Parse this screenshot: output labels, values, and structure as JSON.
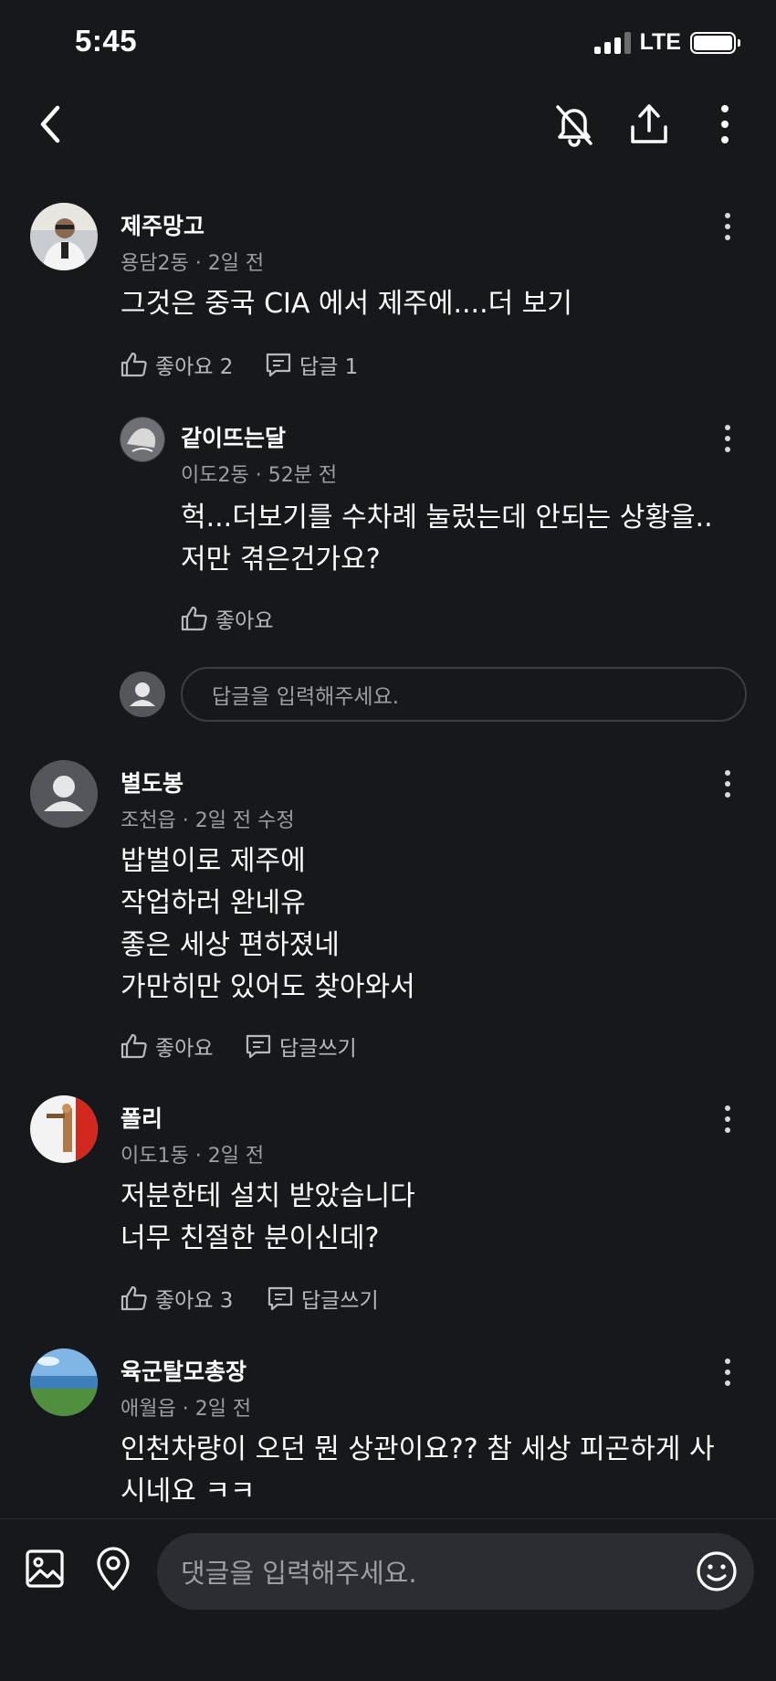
{
  "status_bar": {
    "time": "5:45",
    "network": "LTE"
  },
  "nav": {
    "back_icon": "chevron-left-icon",
    "bell_icon": "bell-off-icon",
    "share_icon": "share-icon",
    "more_icon": "more-vertical-icon"
  },
  "comments": [
    {
      "author": "제주망고",
      "meta": "용담2동 · 2일 전",
      "text": "그것은 중국 CIA 에서 제주에....더 보기",
      "like_label": "좋아요 2",
      "reply_label": "답글 1",
      "replies": [
        {
          "author": "같이뜨는달",
          "meta": "이도2동 · 52분 전",
          "text_line1": "헉...더보기를 수차례 눌렀는데 안되는 상황을..",
          "text_line2": "저만 겪은건가요?",
          "like_label": "좋아요"
        }
      ],
      "reply_input_placeholder": "답글을 입력해주세요."
    },
    {
      "author": "별도봉",
      "meta": "조천읍 · 2일 전 수정",
      "lines": [
        "밥벌이로 제주에",
        "작업하러 완네유",
        "좋은 세상 편하졌네",
        "가만히만 있어도 찾아와서"
      ],
      "like_label": "좋아요",
      "reply_label": "답글쓰기"
    },
    {
      "author": "폴리",
      "meta": "이도1동 · 2일 전",
      "lines": [
        "저분한테 설치 받았습니다",
        "너무 친절한 분이신데?"
      ],
      "like_label": "좋아요 3",
      "reply_label": "답글쓰기"
    },
    {
      "author": "육군탈모총장",
      "meta": "애월읍 · 2일 전",
      "lines": [
        "인천차량이 오던 뭔 상관이요?? 참 세상 피곤하게 사",
        "시네요 ㅋㅋ"
      ]
    }
  ],
  "bottom_bar": {
    "comment_placeholder": "댓글을 입력해주세요.",
    "image_icon": "image-icon",
    "location_icon": "location-pin-icon",
    "emoji_icon": "smile-icon"
  },
  "colors": {
    "background": "#17181c",
    "secondary_text": "#9d9ea3",
    "input_background": "#2c2d32"
  }
}
